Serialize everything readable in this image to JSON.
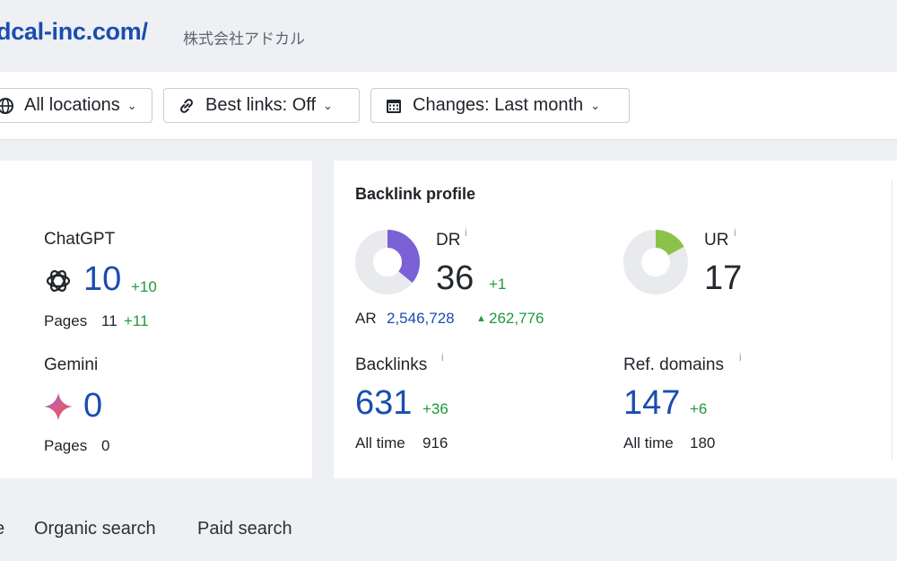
{
  "header": {
    "site_url": "dcal-inc.com/",
    "site_name": "株式会社アドカル"
  },
  "filters": {
    "locations": "All locations",
    "best_links": "Best links: Off",
    "changes": "Changes: Last month"
  },
  "ai_panel": {
    "chatgpt": {
      "label": "ChatGPT",
      "value": "10",
      "delta": "+10",
      "pages_label": "Pages",
      "pages_value": "11",
      "pages_delta": "+11"
    },
    "gemini": {
      "label": "Gemini",
      "value": "0",
      "pages_label": "Pages",
      "pages_value": "0"
    }
  },
  "backlink_profile": {
    "title": "Backlink profile",
    "dr": {
      "label": "DR",
      "value": "36",
      "delta": "+1",
      "ring_fraction": 0.36,
      "color": "#7b61d6"
    },
    "ur": {
      "label": "UR",
      "value": "17",
      "ring_fraction": 0.17,
      "color": "#8bc34a"
    },
    "ar": {
      "label": "AR",
      "value": "2,546,728",
      "delta": "262,776"
    },
    "backlinks": {
      "label": "Backlinks",
      "value": "631",
      "delta": "+36",
      "all_time_label": "All time",
      "all_time_value": "916"
    },
    "ref_domains": {
      "label": "Ref. domains",
      "value": "147",
      "delta": "+6",
      "all_time_label": "All time",
      "all_time_value": "180"
    },
    "info_mark": "i"
  },
  "tabs": {
    "partial": "e",
    "organic": "Organic search",
    "paid": "Paid search"
  },
  "colors": {
    "accent_blue": "#1a4db0",
    "positive_green": "#1f9a3b",
    "ring_track": "#e8eaed"
  },
  "icons": [
    "globe-icon",
    "link-icon",
    "calendar-icon",
    "chevron-down-icon",
    "chatgpt-icon",
    "gemini-icon",
    "caret-up-icon"
  ]
}
